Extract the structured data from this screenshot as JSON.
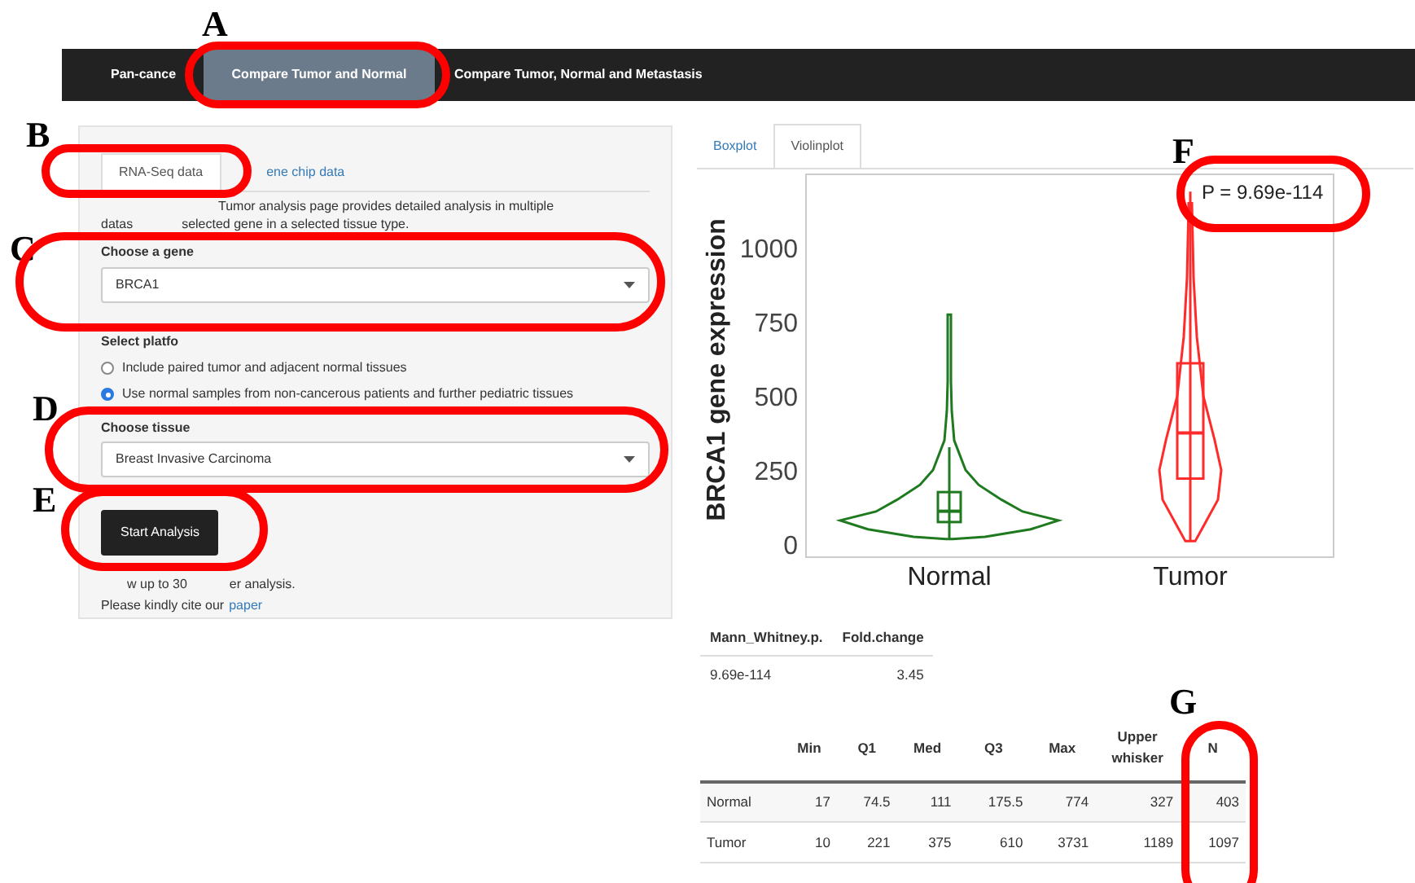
{
  "navbar": {
    "items": [
      {
        "label": "Pan-cance",
        "selected": false
      },
      {
        "label": "Compare Tumor and Normal",
        "selected": true
      },
      {
        "label": "Compare Tumor, Normal and Metastasis",
        "selected": false
      }
    ]
  },
  "form": {
    "tabs": [
      {
        "label": "RNA-Seq data",
        "selected": true
      },
      {
        "label": "ene chip data",
        "selected": false
      }
    ],
    "description": [
      "Tumor analysis page provides detailed analysis in multiple",
      "datas",
      "selected gene in a selected tissue type."
    ],
    "gene_label": "Choose a gene",
    "gene_value": "BRCA1",
    "platform_label": "Select platfo",
    "platforms": [
      {
        "label": "Include paired tumor and adjacent normal tissues",
        "selected": false
      },
      {
        "label": "Use normal samples from non-cancerous patients and further pediatric tissues",
        "selected": true
      }
    ],
    "tissue_label": "Choose tissue",
    "tissue_value": "Breast Invasive Carcinoma",
    "button": "Start Analysis",
    "note": [
      "w up to 30",
      "er analysis."
    ],
    "cite": "Please kindly cite our",
    "cite_link": "paper"
  },
  "plot_tabs": [
    {
      "label": "Boxplot",
      "selected": false
    },
    {
      "label": "Violinplot",
      "selected": true
    }
  ],
  "plot": {
    "ylabel": "BRCA1 gene expression",
    "yticks": [
      "1000",
      "750",
      "500",
      "250",
      "0"
    ],
    "categories": [
      "Normal",
      "Tumor"
    ],
    "p_value": "P = 9.69e-114"
  },
  "test_table": {
    "columns": [
      "Mann_Whitney.p.",
      "Fold.change"
    ],
    "rows": [
      [
        "9.69e-114",
        "3.45"
      ]
    ]
  },
  "stats_table": {
    "columns": [
      "",
      "Min",
      "Q1",
      "Med",
      "Q3",
      "Max",
      "Upper whisker",
      "N"
    ],
    "rows": [
      [
        "Normal",
        "17",
        "74.5",
        "111",
        "175.5",
        "774",
        "327",
        "403"
      ],
      [
        "Tumor",
        "10",
        "221",
        "375",
        "610",
        "3731",
        "1189",
        "1097"
      ]
    ]
  },
  "annotations": [
    {
      "label": "A"
    },
    {
      "label": "B"
    },
    {
      "label": "C"
    },
    {
      "label": "D"
    },
    {
      "label": "E"
    },
    {
      "label": "F"
    },
    {
      "label": "G"
    }
  ]
}
